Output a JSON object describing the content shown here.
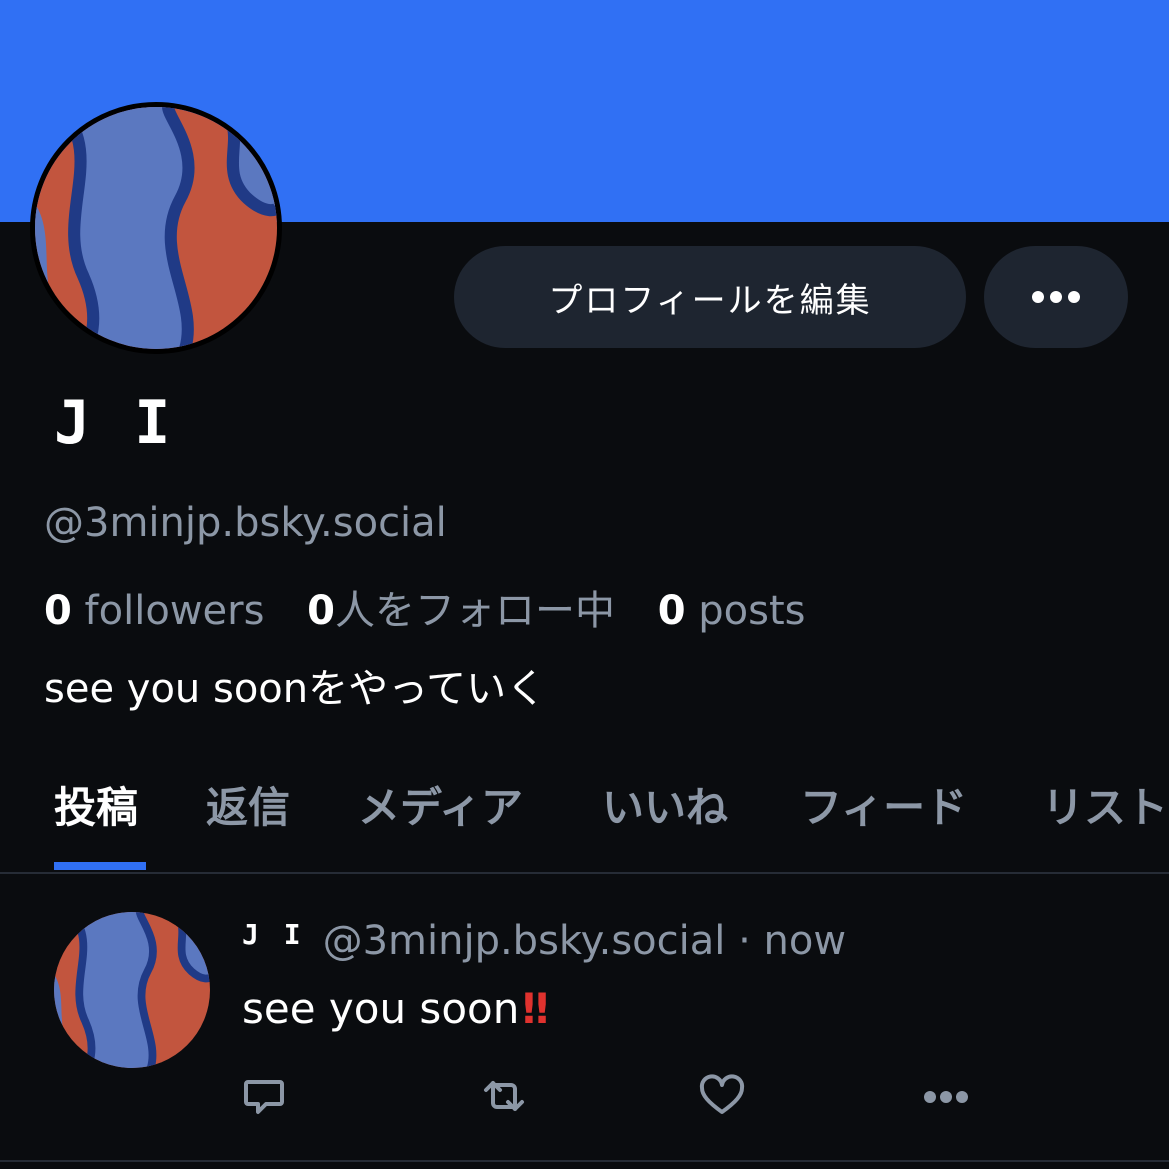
{
  "profile": {
    "display_name": "J I",
    "handle": "@3minjp.bsky.social",
    "bio": "see you soonをやっていく",
    "banner_color": "#3070f4",
    "edit_button_label": "プロフィールを編集",
    "more_icon": "ellipsis-icon",
    "stats": {
      "followers_count": "0",
      "followers_label": " followers",
      "following_count": "0",
      "following_label": "人をフォロー中",
      "posts_count": "0",
      "posts_label": " posts"
    }
  },
  "tabs": [
    {
      "label": "投稿",
      "active": true
    },
    {
      "label": "返信",
      "active": false
    },
    {
      "label": "メディア",
      "active": false
    },
    {
      "label": "いいね",
      "active": false
    },
    {
      "label": "フィード",
      "active": false
    },
    {
      "label": "リスト",
      "active": false
    }
  ],
  "post": {
    "author_name": "J I",
    "author_handle": "@3minjp.bsky.social",
    "separator": " · ",
    "time": "now",
    "text": "see you soon",
    "emoji": "!!",
    "actions": [
      "reply-icon",
      "repost-icon",
      "like-icon",
      "more-icon"
    ]
  },
  "colors": {
    "background": "#0a0c0f",
    "accent": "#3070f4",
    "muted_text": "#8c97a6",
    "button_bg": "#1e2530"
  }
}
